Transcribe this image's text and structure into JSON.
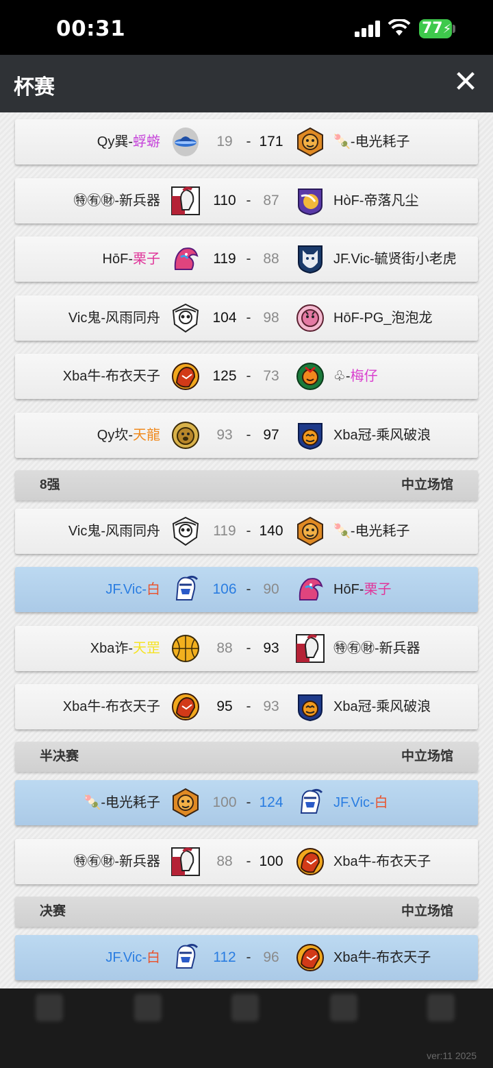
{
  "status_bar": {
    "time": "00:31",
    "battery": "77"
  },
  "header": {
    "title": "杯赛",
    "close": "✕"
  },
  "rounds": {
    "qf": {
      "name": "8强",
      "venue": "中立场馆"
    },
    "sf": {
      "name": "半决赛",
      "venue": "中立场馆"
    },
    "final": {
      "name": "决赛",
      "venue": "中立场馆"
    }
  },
  "matches": [
    {
      "home_a": "Qy巽-",
      "home_b": "蜉蝣",
      "home_score": "19",
      "away_score": "171",
      "away_a": "🍡-电光耗子",
      "away_b": ""
    },
    {
      "home_a": "㊕㊒㊖-新兵器",
      "home_b": "",
      "home_score": "110",
      "away_score": "87",
      "away_a": "HòF-帝落凡尘",
      "away_b": ""
    },
    {
      "home_a": "HōF-",
      "home_b": "栗子",
      "home_score": "119",
      "away_score": "88",
      "away_a": "JF.Vic-毓贤街小老虎",
      "away_b": ""
    },
    {
      "home_a": "Vic鬼-风雨同舟",
      "home_b": "",
      "home_score": "104",
      "away_score": "98",
      "away_a": "HōF-PG_泡泡龙",
      "away_b": ""
    },
    {
      "home_a": "Xba牛-布衣天子",
      "home_b": "",
      "home_score": "125",
      "away_score": "73",
      "away_a": "♧-",
      "away_b": "梅仔"
    },
    {
      "home_a": "Qy坎-",
      "home_b": "天龍",
      "home_score": "93",
      "away_score": "97",
      "away_a": "Xba冠-乘风破浪",
      "away_b": ""
    },
    {
      "home_a": "Vic鬼-风雨同舟",
      "home_b": "",
      "home_score": "119",
      "away_score": "140",
      "away_a": "🍡-电光耗子",
      "away_b": ""
    },
    {
      "home_a": "JF.Vic-",
      "home_b": "白",
      "home_score": "106",
      "away_score": "90",
      "away_a": "HōF-",
      "away_b": "栗子"
    },
    {
      "home_a": "Xba诈-",
      "home_b": "天罡",
      "home_score": "88",
      "away_score": "93",
      "away_a": "㊕㊒㊖-新兵器",
      "away_b": ""
    },
    {
      "home_a": "Xba牛-布衣天子",
      "home_b": "",
      "home_score": "95",
      "away_score": "93",
      "away_a": "Xba冠-乘风破浪",
      "away_b": ""
    },
    {
      "home_a": "🍡-电光耗子",
      "home_b": "",
      "home_score": "100",
      "away_score": "124",
      "away_a": "JF.Vic-",
      "away_b": "白"
    },
    {
      "home_a": "㊕㊒㊖-新兵器",
      "home_b": "",
      "home_score": "88",
      "away_score": "100",
      "away_a": "Xba牛-布衣天子",
      "away_b": ""
    },
    {
      "home_a": "JF.Vic-",
      "home_b": "白",
      "home_score": "112",
      "away_score": "96",
      "away_a": "Xba牛-布衣天子",
      "away_b": ""
    }
  ],
  "logos": {
    "ufo": "ufo-logo-icon",
    "tiger": "tiger-logo-icon",
    "spartan": "spartan-logo-icon",
    "vortex": "purple-vortex-logo-icon",
    "dragon": "pink-dragon-logo-icon",
    "wolf": "wolf-shield-logo-icon",
    "skull": "skull-logo-icon",
    "pinktiger": "pink-tiger-logo-icon",
    "demon": "demon-logo-icon",
    "jester": "jester-logo-icon",
    "dog": "dog-logo-icon",
    "pumpkin": "pumpkin-logo-icon",
    "knight": "knight-logo-icon",
    "ball": "basketball-logo-icon"
  },
  "version": "ver:11  2025"
}
